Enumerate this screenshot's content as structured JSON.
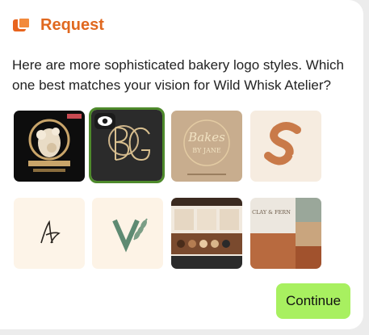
{
  "header": {
    "title": "Request",
    "icon": "request-icon"
  },
  "question": "Here are more sophisticated bakery logo styles. Which one best matches your vision for Wild Whisk Atelier?",
  "options": [
    {
      "id": "option-1",
      "icon": "black-gold-cake-logo"
    },
    {
      "id": "option-2",
      "icon": "bg-monogram-logo",
      "selected": true,
      "badge_icon": "eye-icon"
    },
    {
      "id": "option-3",
      "icon": "gold-script-logo",
      "lettering": "Bakes by Jane"
    },
    {
      "id": "option-4",
      "icon": "s-leaf-logo",
      "lettering": "S"
    },
    {
      "id": "option-5",
      "icon": "script-monogram-logo"
    },
    {
      "id": "option-6",
      "icon": "v-wheat-logo",
      "lettering": "V"
    },
    {
      "id": "option-7",
      "icon": "brand-board-palette"
    },
    {
      "id": "option-8",
      "icon": "clay-and-fern-board",
      "lettering": "CLAY & FERN"
    }
  ],
  "actions": {
    "continue_label": "Continue"
  },
  "colors": {
    "accent": "#e0681f",
    "continue_bg": "#a8f060",
    "selected_border": "#4e8a2b"
  }
}
